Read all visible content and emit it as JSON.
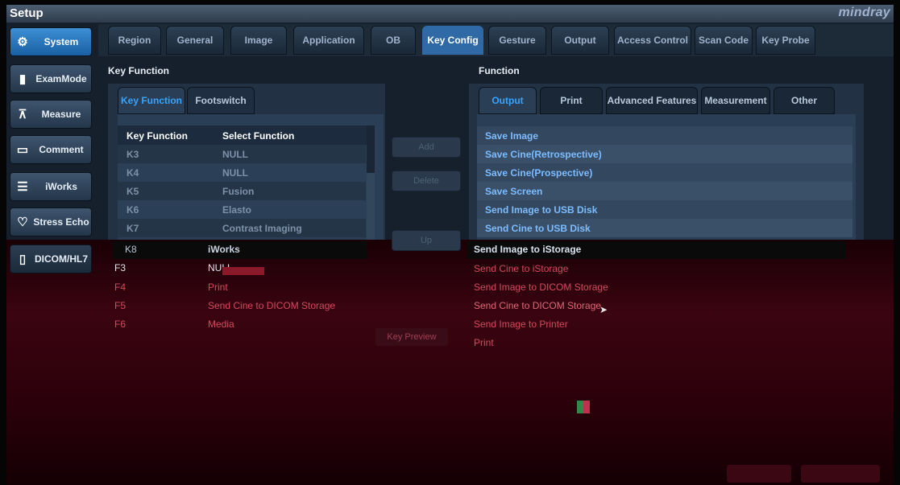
{
  "window": {
    "title": "Setup",
    "brand": "mindray"
  },
  "sidebar": {
    "items": [
      {
        "label": "System",
        "icon": "gear-icon",
        "active": true
      },
      {
        "label": "ExamMode",
        "icon": "exam-mode-icon"
      },
      {
        "label": "Measure",
        "icon": "caliper-icon"
      },
      {
        "label": "Comment",
        "icon": "comment-icon"
      },
      {
        "label": "iWorks",
        "icon": "iworks-icon"
      },
      {
        "label": "Stress Echo",
        "icon": "heart-icon"
      },
      {
        "label": "DICOM/HL7",
        "icon": "dicom-icon"
      }
    ]
  },
  "tabs": [
    {
      "label": "Region"
    },
    {
      "label": "General"
    },
    {
      "label": "Image"
    },
    {
      "label": "Application"
    },
    {
      "label": "OB"
    },
    {
      "label": "Key Config",
      "active": true
    },
    {
      "label": "Gesture"
    },
    {
      "label": "Output"
    },
    {
      "label": "Access Control"
    },
    {
      "label": "Scan Code"
    },
    {
      "label": "Key Probe"
    }
  ],
  "key_function_section": {
    "title": "Key Function",
    "subtabs": [
      {
        "label": "Key Function",
        "active": true
      },
      {
        "label": "Footswitch"
      }
    ],
    "columns": [
      "Key Function",
      "Select Function"
    ],
    "rows": [
      {
        "key": "K3",
        "func": "NULL"
      },
      {
        "key": "K4",
        "func": "NULL"
      },
      {
        "key": "K5",
        "func": "Fusion"
      },
      {
        "key": "K6",
        "func": "Elasto"
      },
      {
        "key": "K7",
        "func": "Contrast Imaging"
      },
      {
        "key": "K8",
        "func": "iWorks"
      },
      {
        "key": "F3",
        "func": "NULL"
      },
      {
        "key": "F4",
        "func": "Print"
      },
      {
        "key": "F5",
        "func": "Send Cine to DICOM Storage"
      },
      {
        "key": "F6",
        "func": "Media"
      }
    ]
  },
  "buttons": {
    "add": "Add",
    "delete": "Delete",
    "up": "Up",
    "key_preview": "Key Preview"
  },
  "function_section": {
    "title": "Function",
    "subtabs": [
      {
        "label": "Output",
        "active": true
      },
      {
        "label": "Print"
      },
      {
        "label": "Advanced Features"
      },
      {
        "label": "Measurement"
      },
      {
        "label": "Other"
      }
    ],
    "items": [
      "Save Image",
      "Save Cine(Retrospective)",
      "Save Cine(Prospective)",
      "Save Screen",
      "Send Image to USB Disk",
      "Send Cine to USB Disk",
      "Send Image to iStorage",
      "Send Cine to iStorage",
      "Send Image to DICOM Storage",
      "Send Cine to DICOM Storage",
      "Send Image to Printer",
      "Print"
    ]
  },
  "colors": {
    "accent": "#38a4ff",
    "active_tab": "#2f6aa6",
    "glitch_red": "#3a0410"
  }
}
